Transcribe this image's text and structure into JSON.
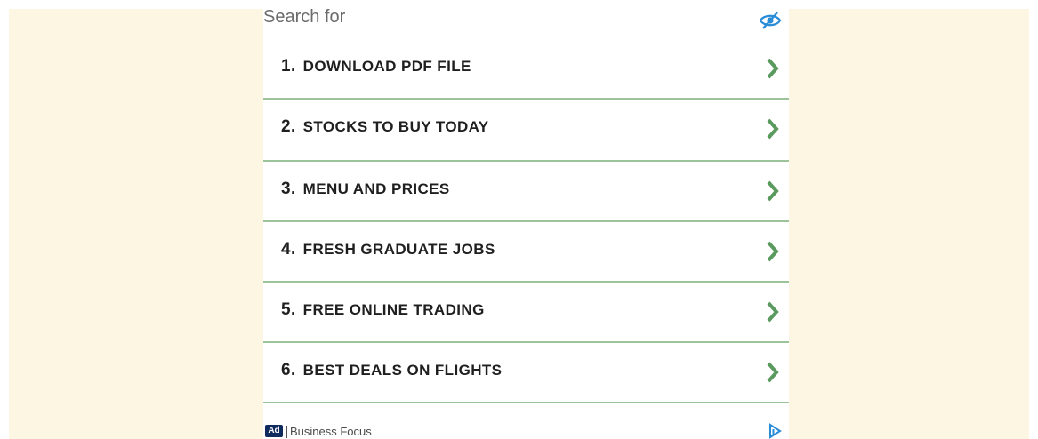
{
  "colors": {
    "page_background": "#fdf6e3",
    "divider": "#9cc39a",
    "chevron": "#5b9a5f",
    "eye_icon": "#2a8bd6",
    "ad_badge": "#0f2a5c",
    "adchoices": "#2a8bd6"
  },
  "header": {
    "search_for": "Search for",
    "hide_icon": "eye-slash-icon"
  },
  "items": [
    {
      "num": "1.",
      "label": "DOWNLOAD PDF FILE"
    },
    {
      "num": "2.",
      "label": "STOCKS TO BUY TODAY"
    },
    {
      "num": "3.",
      "label": "MENU AND PRICES"
    },
    {
      "num": "4.",
      "label": "FRESH GRADUATE JOBS"
    },
    {
      "num": "5.",
      "label": "FREE ONLINE TRADING"
    },
    {
      "num": "6.",
      "label": "BEST DEALS ON FLIGHTS"
    }
  ],
  "footer": {
    "ad_badge": "Ad",
    "brand": "Business Focus",
    "adchoices_icon": "adchoices-icon"
  }
}
